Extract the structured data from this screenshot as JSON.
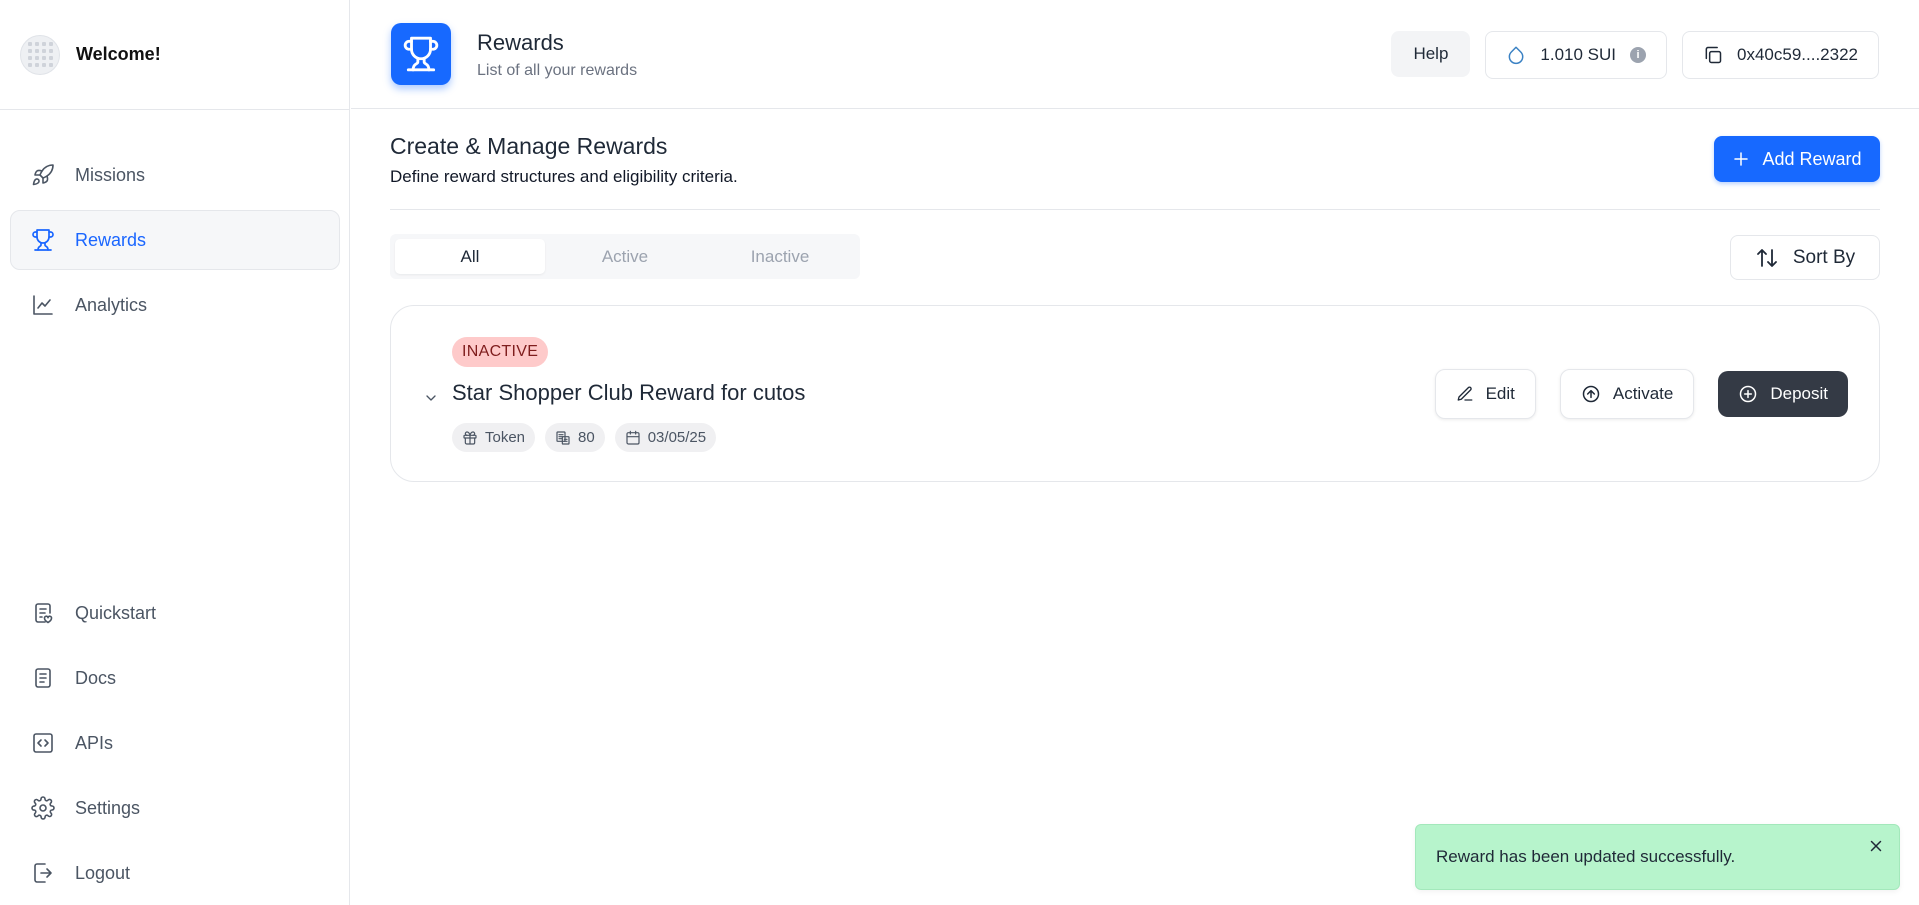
{
  "sidebar": {
    "welcome": "Welcome!",
    "nav_top": [
      {
        "label": "Missions",
        "icon": "rocket-icon"
      },
      {
        "label": "Rewards",
        "icon": "trophy-icon",
        "active": true
      },
      {
        "label": "Analytics",
        "icon": "chart-line-icon"
      }
    ],
    "nav_bottom": [
      {
        "label": "Quickstart",
        "icon": "checklist-icon"
      },
      {
        "label": "Docs",
        "icon": "document-icon"
      },
      {
        "label": "APIs",
        "icon": "code-icon"
      },
      {
        "label": "Settings",
        "icon": "gear-icon"
      },
      {
        "label": "Logout",
        "icon": "logout-icon"
      }
    ]
  },
  "header": {
    "title": "Rewards",
    "subtitle": "List of all your rewards",
    "help_label": "Help",
    "balance": "1.010 SUI",
    "wallet": "0x40c59....2322",
    "info_glyph": "i"
  },
  "main": {
    "title": "Create & Manage Rewards",
    "subtitle": "Define reward structures and eligibility criteria.",
    "add_label": "Add Reward",
    "tabs": [
      "All",
      "Active",
      "Inactive"
    ],
    "sort_label": "Sort By",
    "reward": {
      "status": "INACTIVE",
      "title": "Star Shopper Club Reward for cutos",
      "type": "Token",
      "amount": "80",
      "date": "03/05/25",
      "edit_label": "Edit",
      "activate_label": "Activate",
      "deposit_label": "Deposit"
    }
  },
  "toast": {
    "message": "Reward has been updated successfully."
  },
  "colors": {
    "accent": "#1769ff",
    "inactive_badge": "#fecaca",
    "toast_bg": "#b7f4cc",
    "dark_button": "#343a45"
  }
}
